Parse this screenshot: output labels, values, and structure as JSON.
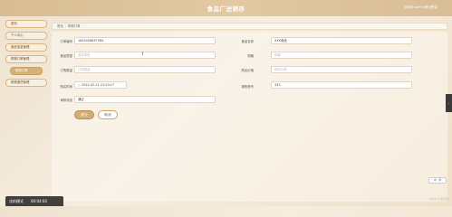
{
  "header": {
    "title": "食品厂进销存",
    "user": "欢迎你 admin",
    "exit_label": "退出登录"
  },
  "sidebar": {
    "items": [
      {
        "label": "首页"
      },
      {
        "label": "个人中心"
      },
      {
        "label": "食品信息管理"
      },
      {
        "label": "购物订单管理"
      },
      {
        "label": "购物订单"
      },
      {
        "label": "购物退货管理"
      }
    ]
  },
  "breadcrumb": {
    "home": "首页",
    "current": "购物订单"
  },
  "form": {
    "order_no_label": "订单编号",
    "order_no_value": "1645458637584",
    "food_name_label": "食品名称",
    "food_name_value": "XXX食品",
    "food_type_label": "食品类型",
    "food_type_placeholder": "食品类型",
    "spec_label": "规格",
    "spec_placeholder": "规格",
    "order_qty_label": "订购数量",
    "order_qty_placeholder": "订购数量",
    "price_label": "购买价格",
    "price_placeholder": "购买价格",
    "buy_time_label": "购买时间",
    "buy_time_value": "2022-02-21 21:20:17",
    "account_label": "销售账号",
    "account_value": "333",
    "status_label": "审核状态",
    "status_value": "通过"
  },
  "buttons": {
    "submit": "提交",
    "cancel": "取消"
  },
  "player": {
    "label": "试听模式",
    "time": "00:04:04"
  },
  "right_tab": "⋮",
  "chip": "中 · 简",
  "watermark": "CSDN @源码阁"
}
